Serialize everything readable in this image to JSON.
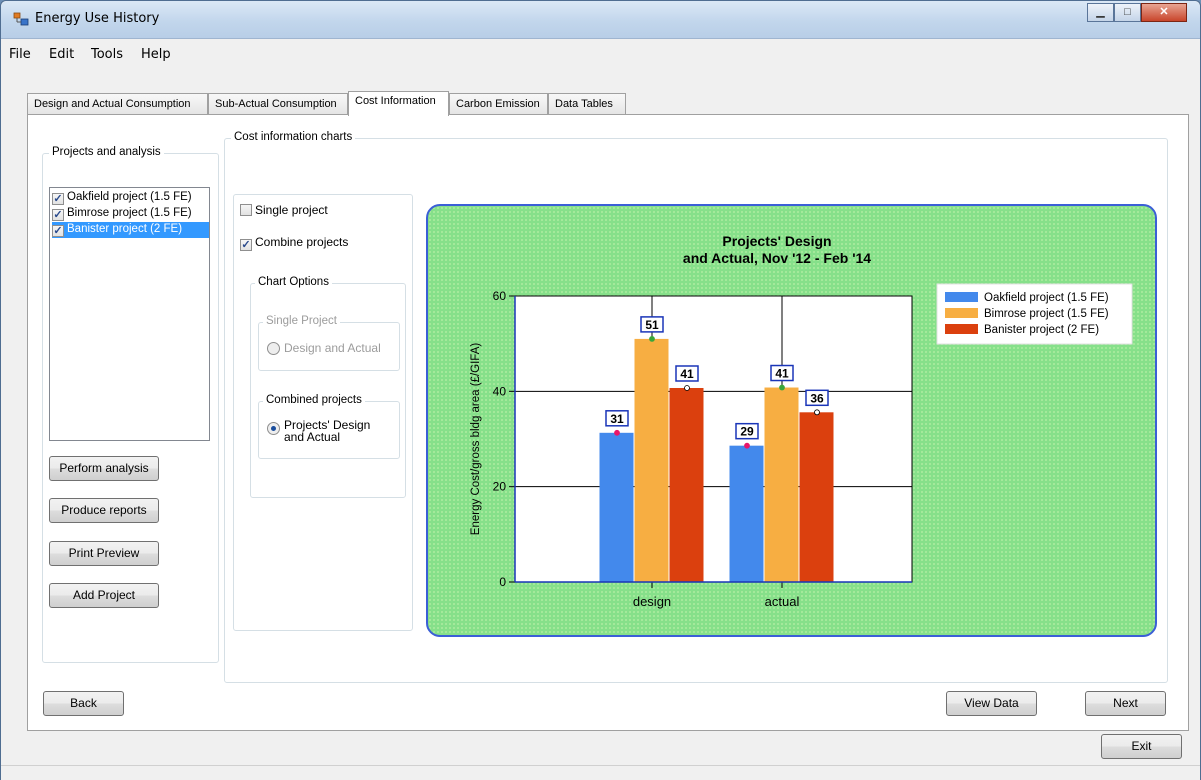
{
  "window": {
    "title": "Energy Use History",
    "minimize_icon": "minimize-icon",
    "maximize_icon": "maximize-icon",
    "close_icon": "close-icon"
  },
  "menu": [
    "File",
    "Edit",
    "Tools",
    "Help"
  ],
  "tabs": [
    {
      "label": "Design and Actual Consumption",
      "active": false
    },
    {
      "label": "Sub-Actual Consumption",
      "active": false
    },
    {
      "label": "Cost Information",
      "active": true
    },
    {
      "label": "Carbon Emission",
      "active": false
    },
    {
      "label": "Data Tables",
      "active": false
    }
  ],
  "projects_group": {
    "label": "Projects and analysis",
    "items": [
      {
        "label": "Oakfield project (1.5 FE)",
        "checked": true,
        "selected": false
      },
      {
        "label": "Bimrose project (1.5 FE)",
        "checked": true,
        "selected": false
      },
      {
        "label": "Banister project (2 FE)",
        "checked": true,
        "selected": true
      }
    ],
    "buttons": {
      "perform": "Perform analysis",
      "reports": "Produce reports",
      "preview": "Print Preview",
      "add": "Add Project"
    }
  },
  "cost_group": {
    "label": "Cost information charts",
    "single_project": {
      "label": "Single project",
      "checked": false
    },
    "combine_projects": {
      "label": "Combine projects",
      "checked": true
    },
    "chart_options": {
      "label": "Chart Options",
      "single_group": {
        "label": "Single Project",
        "option": "Design and Actual"
      },
      "combined_group": {
        "label": "Combined projects",
        "option_line1": "Projects' Design",
        "option_line2": "and Actual"
      }
    }
  },
  "buttons": {
    "back": "Back",
    "view_data": "View Data",
    "next": "Next",
    "exit": "Exit"
  },
  "colors": {
    "oakfield": "#4389ec",
    "bimrose": "#f7ae42",
    "banister": "#db400e",
    "panel_bg": "#86e08a",
    "panel_border": "#3b5fd6"
  },
  "chart_data": {
    "type": "bar",
    "title_line1": "Projects' Design",
    "title_line2": "and Actual, Nov '12 - Feb '14",
    "xlabel": "",
    "ylabel": "Energy Cost/gross bldg area (£/GIFA)",
    "categories": [
      "design",
      "actual"
    ],
    "series": [
      {
        "name": "Oakfield project (1.5 FE)",
        "values": [
          31,
          29
        ],
        "exact": [
          31.3,
          28.6
        ],
        "color": "#4389ec",
        "marker": "#e8166a"
      },
      {
        "name": "Bimrose project (1.5 FE)",
        "values": [
          51,
          41
        ],
        "exact": [
          51.0,
          40.8
        ],
        "color": "#f7ae42",
        "marker": "#3aa63a"
      },
      {
        "name": "Banister project (2 FE)",
        "values": [
          41,
          36
        ],
        "exact": [
          40.7,
          35.6
        ],
        "color": "#db400e",
        "marker": "#ffffff"
      }
    ],
    "ylim": [
      0,
      60
    ],
    "yticks": [
      0,
      20,
      40,
      60
    ],
    "grid": true,
    "legend": "top-right"
  }
}
